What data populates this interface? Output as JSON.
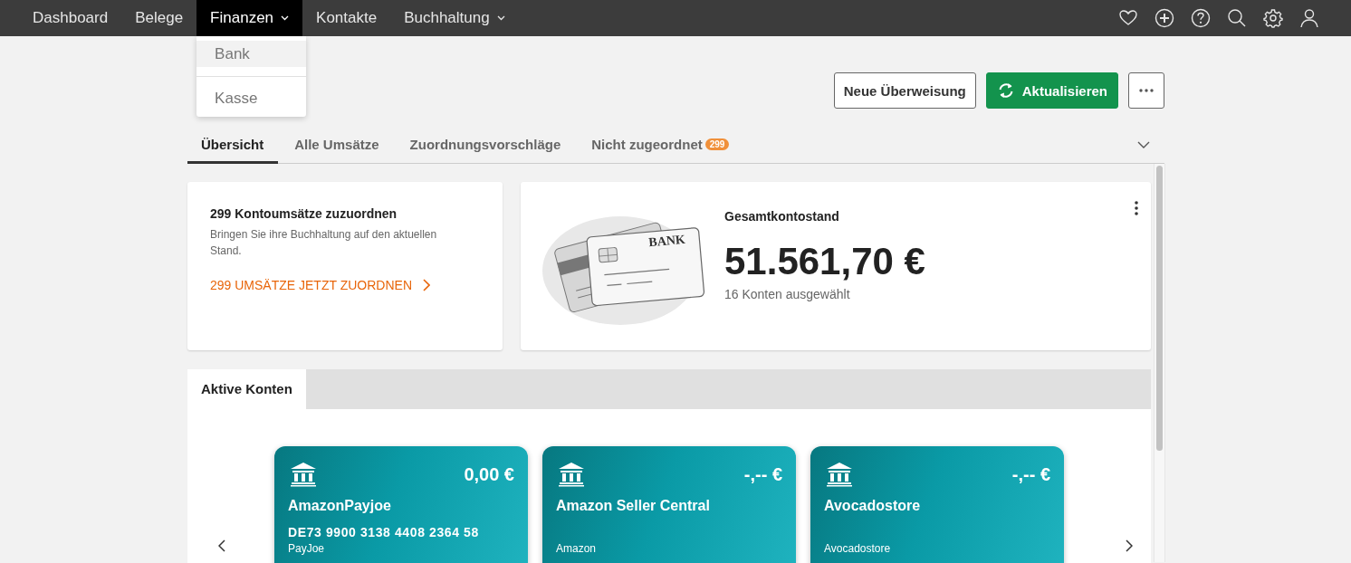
{
  "nav": {
    "items": [
      {
        "label": "Dashboard",
        "selected": false,
        "has_menu": false
      },
      {
        "label": "Belege",
        "selected": false,
        "has_menu": false
      },
      {
        "label": "Finanzen",
        "selected": true,
        "has_menu": true
      },
      {
        "label": "Kontakte",
        "selected": false,
        "has_menu": false
      },
      {
        "label": "Buchhaltung",
        "selected": false,
        "has_menu": true
      }
    ]
  },
  "dropdown": {
    "items": [
      {
        "label": "Bank",
        "selected": true
      },
      {
        "label": "Kasse",
        "selected": false
      }
    ]
  },
  "actions": [
    {
      "kind": "outline",
      "label": "Neue Überweisung"
    },
    {
      "kind": "primary",
      "label": "Aktualisieren"
    },
    {
      "kind": "more"
    }
  ],
  "tabs": [
    {
      "label": "Übersicht",
      "selected": true
    },
    {
      "label": "Alle Umsätze",
      "selected": false
    },
    {
      "label": "Zuordnungsvorschläge",
      "selected": false
    },
    {
      "label": "Nicht zugeordnet",
      "selected": false,
      "badge": "299"
    }
  ],
  "todo_card": {
    "title": "299 Kontoumsätze zuzuordnen",
    "text": "Bringen Sie ihre Buchhaltung auf den aktuellen Stand.",
    "link": "299 UMSÄTZE JETZT ZUORDNEN"
  },
  "balance_card": {
    "illustration_label": "BANK",
    "title": "Gesamtkontostand",
    "amount": "51.561,70 €",
    "subtitle": "16 Konten ausgewählt"
  },
  "accounts_panel": {
    "tab": "Aktive Konten",
    "accounts": [
      {
        "name": "AmazonPayjoe",
        "balance": "0,00 €",
        "iban": "DE73 9900 3138 4408 2364 58",
        "provider": "PayJoe"
      },
      {
        "name": "Amazon Seller Central",
        "balance": "-,-- €",
        "provider": "Amazon"
      },
      {
        "name": "Avocadostore",
        "balance": "-,-- €",
        "provider": "Avocadostore"
      }
    ]
  }
}
